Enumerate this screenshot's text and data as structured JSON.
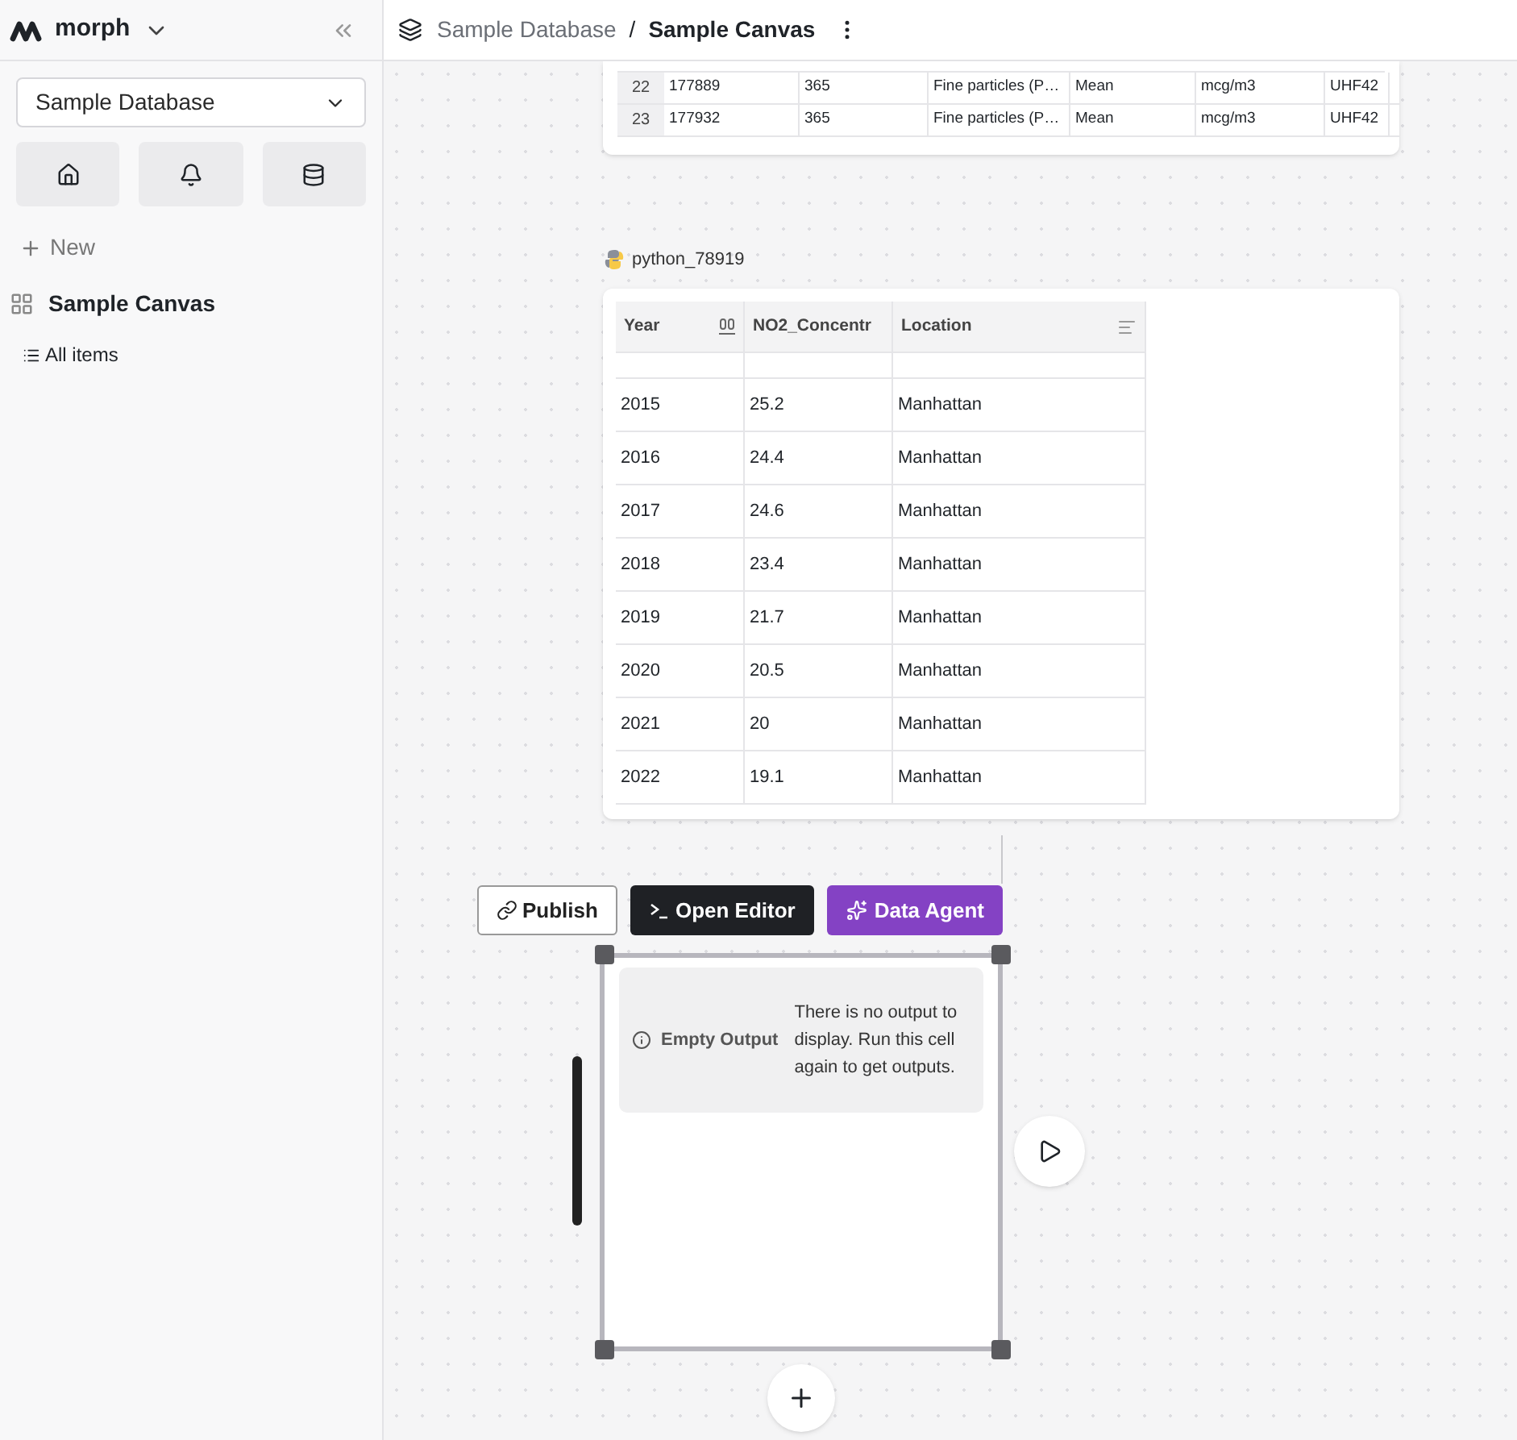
{
  "workspace": {
    "name": "morph"
  },
  "database_select": {
    "value": "Sample Database"
  },
  "new_button": {
    "label": "New"
  },
  "nav": [
    {
      "label": "Sample Canvas",
      "selected": true
    }
  ],
  "all_items": {
    "label": "All items"
  },
  "breadcrumb": {
    "parent": "Sample Database",
    "separator": "/",
    "current": "Sample Canvas"
  },
  "top_table": {
    "rows": [
      {
        "index": "22",
        "cells": [
          "177889",
          "365",
          "Fine particles (P…",
          "Mean",
          "mcg/m3",
          "UHF42"
        ]
      },
      {
        "index": "23",
        "cells": [
          "177932",
          "365",
          "Fine particles (P…",
          "Mean",
          "mcg/m3",
          "UHF42"
        ]
      }
    ]
  },
  "python_cell": {
    "name": "python_78919",
    "columns": [
      "Year",
      "NO2_Concentr",
      "Location"
    ],
    "rows": [
      [
        "2015",
        "25.2",
        "Manhattan"
      ],
      [
        "2016",
        "24.4",
        "Manhattan"
      ],
      [
        "2017",
        "24.6",
        "Manhattan"
      ],
      [
        "2018",
        "23.4",
        "Manhattan"
      ],
      [
        "2019",
        "21.7",
        "Manhattan"
      ],
      [
        "2020",
        "20.5",
        "Manhattan"
      ],
      [
        "2021",
        "20",
        "Manhattan"
      ],
      [
        "2022",
        "19.1",
        "Manhattan"
      ]
    ]
  },
  "toolbar": {
    "publish": "Publish",
    "open_editor": "Open Editor",
    "data_agent": "Data Agent"
  },
  "empty_output": {
    "title": "Empty Output",
    "message": "There is no output to display. Run this cell again to get outputs."
  }
}
